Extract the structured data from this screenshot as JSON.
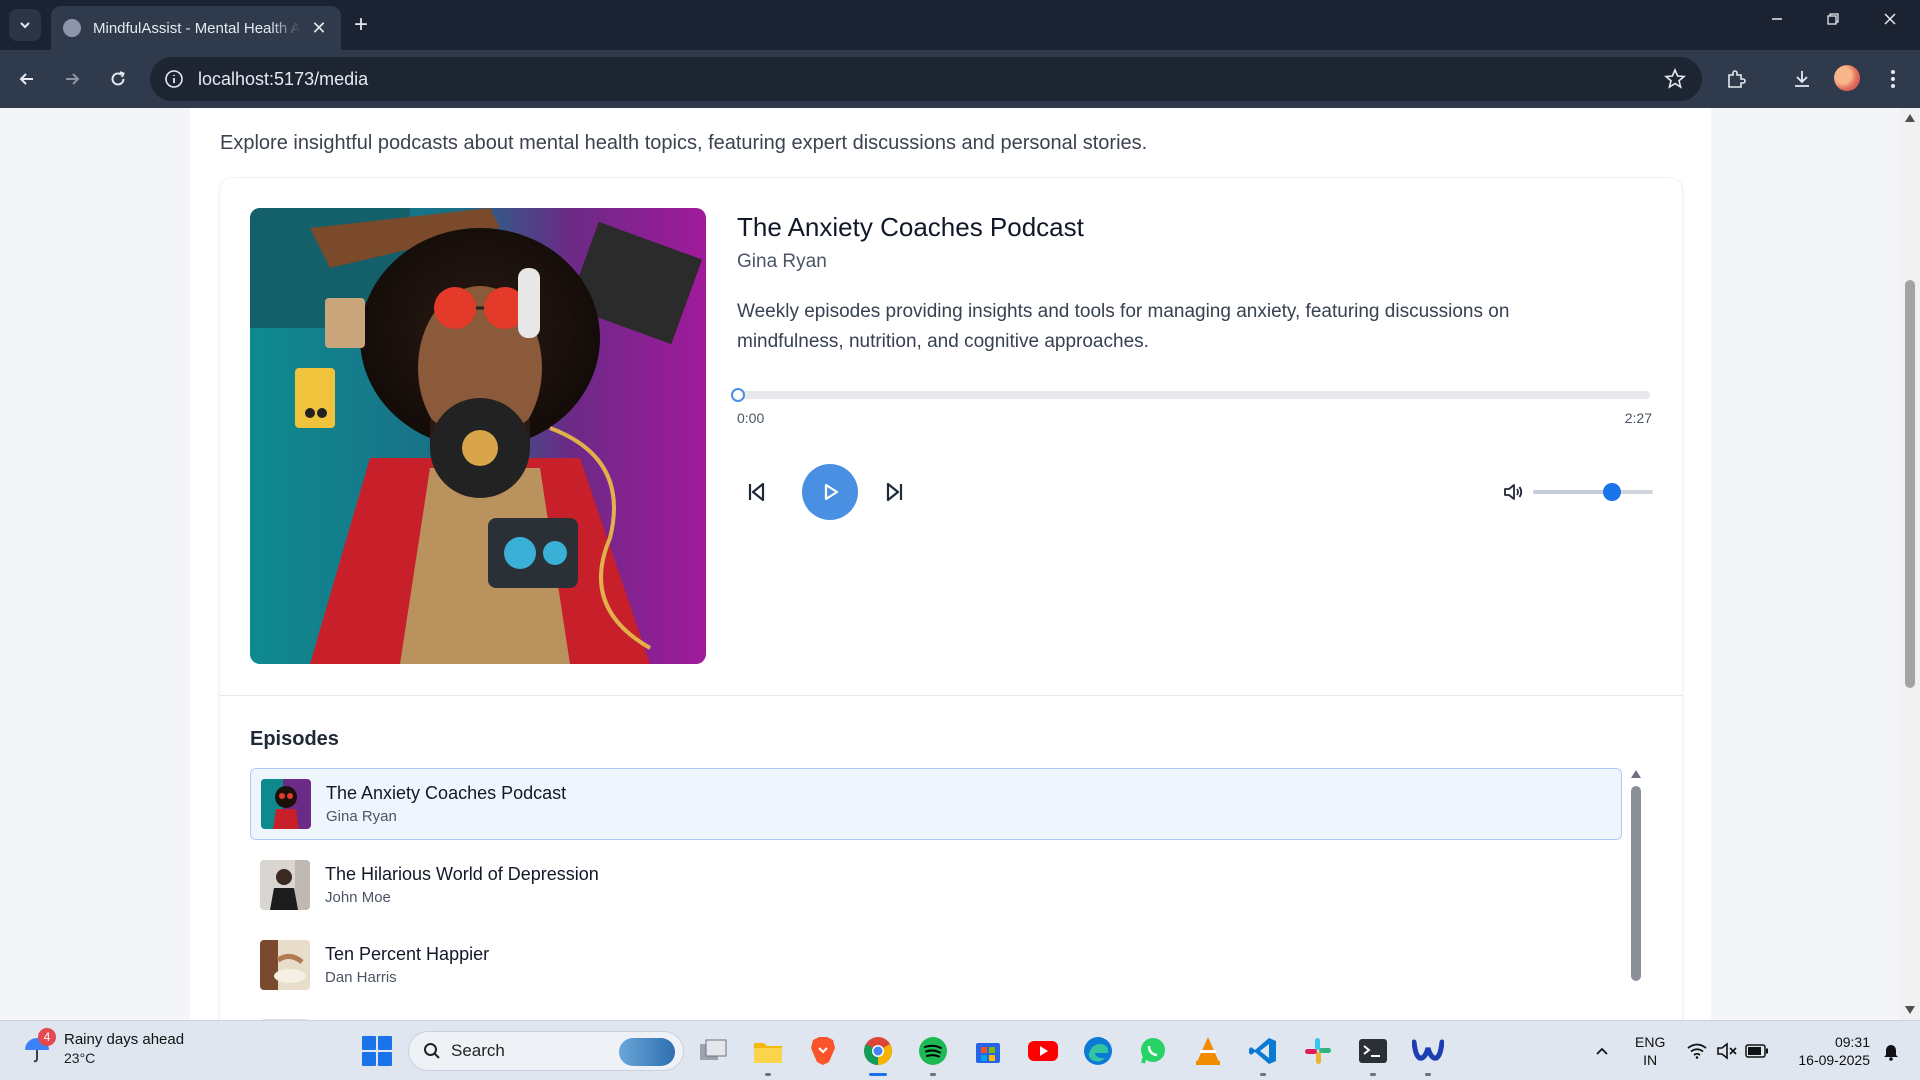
{
  "browser": {
    "tab_title": "MindfulAssist - Mental Health Assistant",
    "url": "localhost:5173/media",
    "new_tab_symbol": "+",
    "close_tab_symbol": "✕"
  },
  "page": {
    "intro": "Explore insightful podcasts about mental health topics, featuring expert discussions and personal stories."
  },
  "player": {
    "title": "The Anxiety Coaches Podcast",
    "author": "Gina Ryan",
    "description": "Weekly episodes providing insights and tools for managing anxiety, featuring discussions on mindfulness, nutrition, and cognitive approaches.",
    "current_time": "0:00",
    "duration": "2:27",
    "progress_percent": 0,
    "volume_percent": 66,
    "accent_color": "#4a90e2"
  },
  "episodes": {
    "heading": "Episodes",
    "items": [
      {
        "title": "The Anxiety Coaches Podcast",
        "author": "Gina Ryan",
        "active": true
      },
      {
        "title": "The Hilarious World of Depression",
        "author": "John Moe",
        "active": false
      },
      {
        "title": "Ten Percent Happier",
        "author": "Dan Harris",
        "active": false
      }
    ]
  },
  "taskbar": {
    "weather_title": "Rainy days ahead",
    "weather_temp": "23°C",
    "weather_badge": "4",
    "search_label": "Search",
    "lang_line1": "ENG",
    "lang_line2": "IN",
    "time": "09:31",
    "date": "16-09-2025",
    "apps": [
      "task-view",
      "file-explorer",
      "brave",
      "chrome",
      "spotify",
      "microsoft-store",
      "youtube",
      "edge",
      "whatsapp",
      "vlc",
      "vscode",
      "slack",
      "terminal",
      "webex"
    ]
  }
}
